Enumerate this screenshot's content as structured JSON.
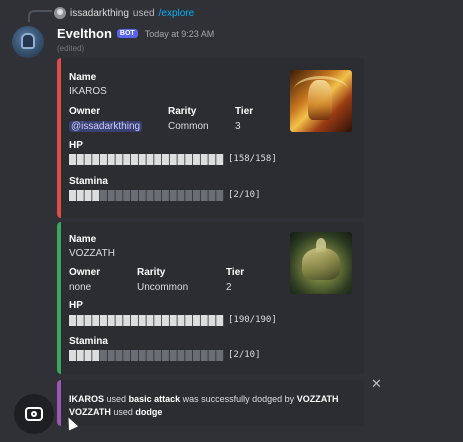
{
  "reply": {
    "username": "issadarkthing",
    "action": "used",
    "command": "/explore"
  },
  "message": {
    "author": "Evelthon",
    "badge": "BOT",
    "timestamp": "Today at 9:23 AM",
    "edited": "(edited)"
  },
  "labels": {
    "name": "Name",
    "owner": "Owner",
    "rarity": "Rarity",
    "tier": "Tier",
    "hp": "HP",
    "stamina": "Stamina"
  },
  "cards": [
    {
      "name": "IKAROS",
      "owner": "@issadarkthing",
      "rarity": "Common",
      "tier": "3",
      "hp_text": "[158/158]",
      "hp_fraction": 1.0,
      "stamina_text": "[2/10]",
      "stamina_fraction": 0.2,
      "accent": "#e04b4b"
    },
    {
      "name": "VOZZATH",
      "owner": "none",
      "rarity": "Uncommon",
      "tier": "2",
      "hp_text": "[190/190]",
      "hp_fraction": 1.0,
      "stamina_text": "[2/10]",
      "stamina_fraction": 0.2,
      "accent": "#3ba55d"
    }
  ],
  "battle_log": {
    "line1": {
      "actor": "IKAROS",
      "used": "used",
      "move": "basic attack",
      "result": "was successfully dodged by",
      "target": "VOZZATH"
    },
    "line2": {
      "actor": "VOZZATH",
      "used": "used",
      "move": "dodge"
    },
    "accent": "#9b59b6"
  },
  "icons": {
    "close": "close-icon",
    "lens": "camera-lens-icon",
    "cursor": "cursor-icon"
  },
  "colors": {
    "background": "#2f3136",
    "embed": "#2b2d31",
    "mention": "#5865f2",
    "bar_filled": "#dcddde",
    "bar_empty": "#6a6d73"
  }
}
